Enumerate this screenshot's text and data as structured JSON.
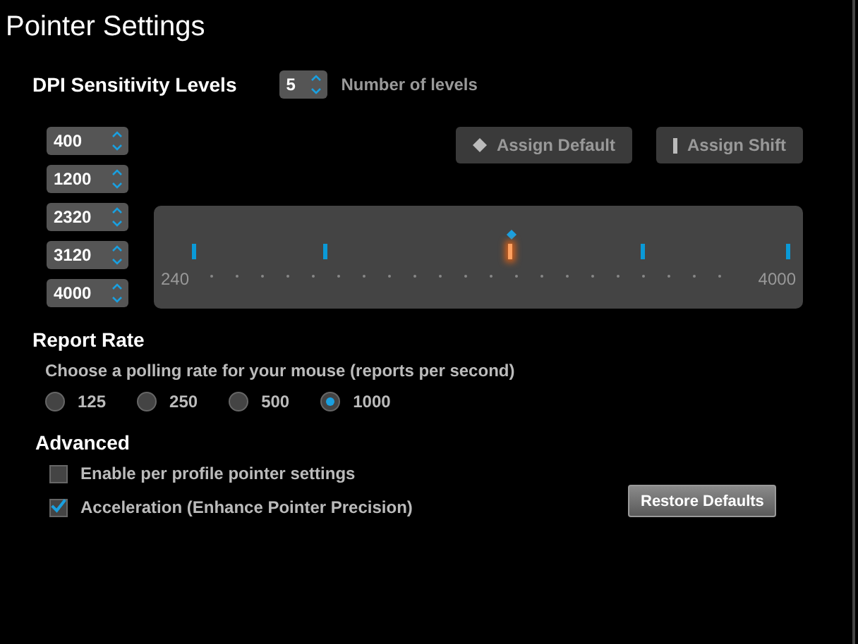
{
  "title": "Pointer Settings",
  "dpi": {
    "heading": "DPI Sensitivity Levels",
    "count": "5",
    "count_label": "Number of levels",
    "levels": [
      {
        "value": "400"
      },
      {
        "value": "1200"
      },
      {
        "value": "2320"
      },
      {
        "value": "3120"
      },
      {
        "value": "4000"
      }
    ],
    "markers": [
      {
        "level": 0.043,
        "default": false,
        "shift": false
      },
      {
        "level": 0.255,
        "default": false,
        "shift": false
      },
      {
        "level": 0.553,
        "default": true,
        "shift": true
      },
      {
        "level": 0.766,
        "default": false,
        "shift": false
      },
      {
        "level": 1.0,
        "default": false,
        "shift": false
      }
    ],
    "buttons": [
      {
        "kind": "default",
        "label": "Assign Default"
      },
      {
        "kind": "shift",
        "label": "Assign Shift"
      }
    ],
    "min": "240",
    "max": "4000"
  },
  "report_rate": {
    "heading": "Report Rate",
    "description": "Choose a polling rate for your mouse (reports per second)",
    "options": [
      {
        "label": "125",
        "selected": false
      },
      {
        "label": "250",
        "selected": false
      },
      {
        "label": "500",
        "selected": false
      },
      {
        "label": "1000",
        "selected": true
      }
    ]
  },
  "advanced": {
    "heading": "Advanced",
    "options": [
      {
        "label": "Enable per profile pointer settings",
        "checked": false
      },
      {
        "label": "Acceleration (Enhance Pointer Precision)",
        "checked": true
      }
    ],
    "restore": "Restore Defaults"
  }
}
